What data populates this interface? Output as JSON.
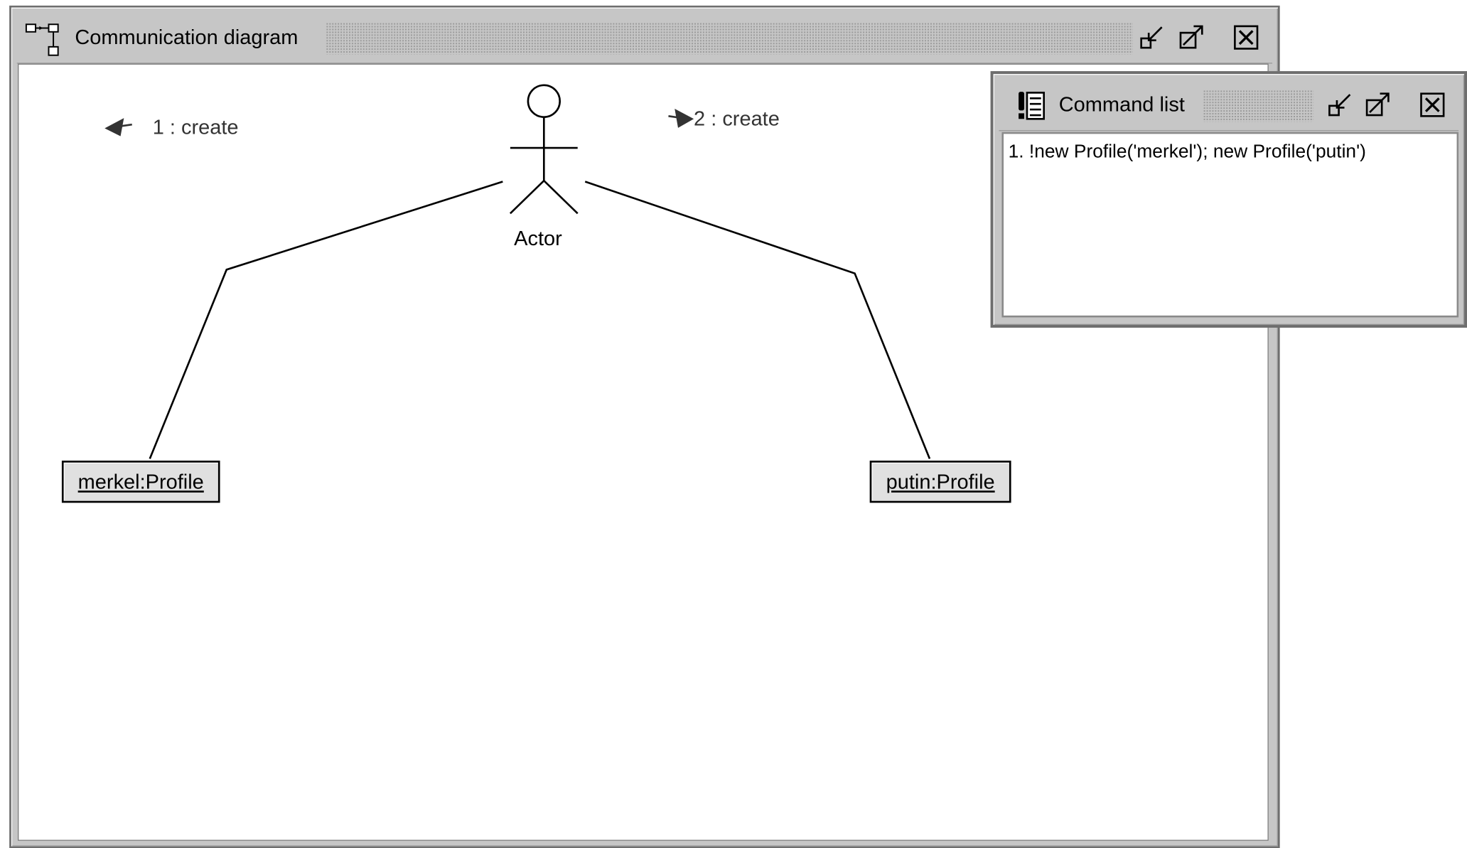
{
  "comm_window": {
    "title": "Communication diagram",
    "diagram": {
      "actor": {
        "label": "Actor"
      },
      "objects": [
        {
          "label": "merkel:Profile"
        },
        {
          "label": "putin:Profile"
        }
      ],
      "messages": [
        {
          "label": "1 : create"
        },
        {
          "label": "2 : create"
        }
      ]
    }
  },
  "command_window": {
    "title": "Command list",
    "commands": [
      "1. !new Profile('merkel'); new Profile('putin')"
    ]
  },
  "icons": {
    "comm_window": "diagram-icon",
    "command_window": "command-list-icon",
    "buttons": [
      "iconify-icon",
      "maximize-icon",
      "close-icon"
    ]
  }
}
